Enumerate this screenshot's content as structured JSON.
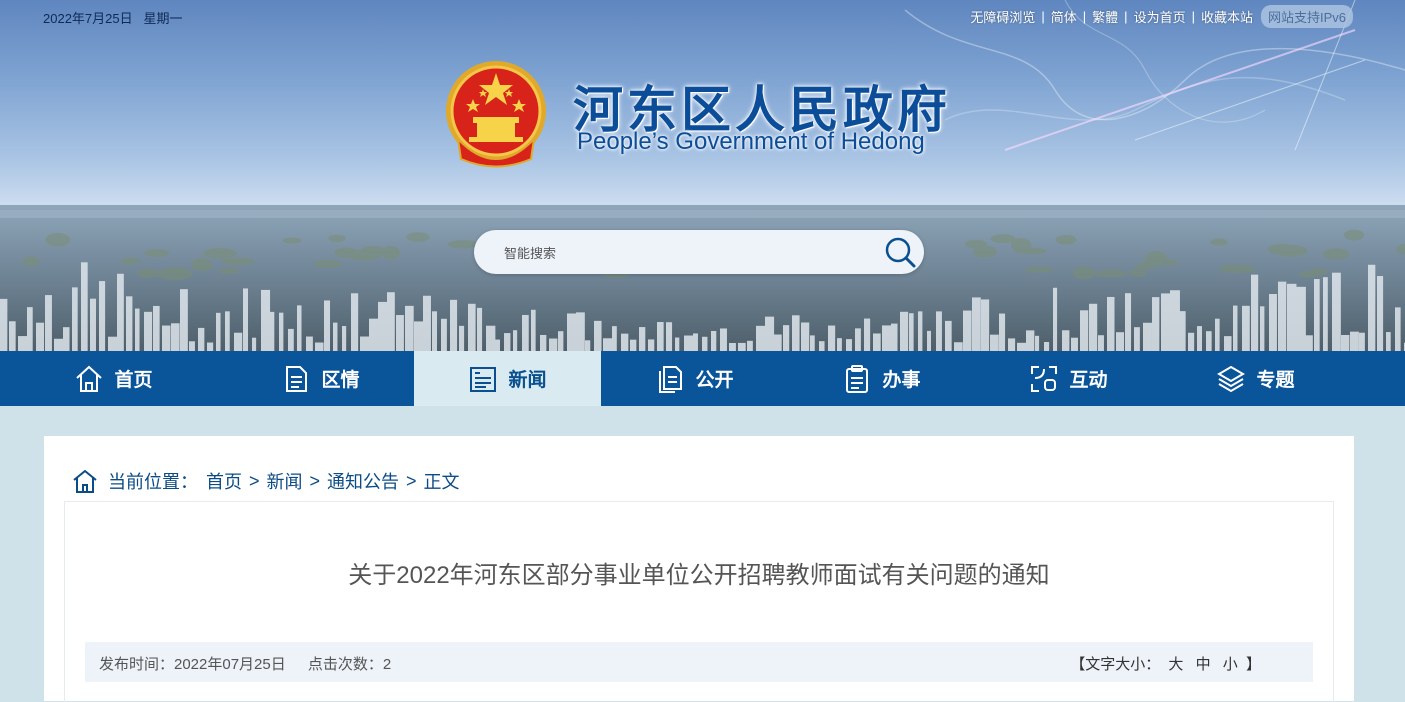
{
  "header": {
    "date": "2022年7月25日",
    "weekday": "星期一",
    "links": [
      "无障碍浏览",
      "简体",
      "繁體",
      "设为首页",
      "收藏本站"
    ],
    "ipv6_badge": "网站支持IPv6",
    "title": "河东区人民政府",
    "subtitle": "People’s Government of Hedong"
  },
  "search": {
    "placeholder": "智能搜索"
  },
  "nav": {
    "items": [
      {
        "label": "首页",
        "icon": "home-icon"
      },
      {
        "label": "区情",
        "icon": "document-icon"
      },
      {
        "label": "新闻",
        "icon": "news-icon"
      },
      {
        "label": "公开",
        "icon": "files-icon"
      },
      {
        "label": "办事",
        "icon": "clipboard-icon"
      },
      {
        "label": "互动",
        "icon": "interaction-icon"
      },
      {
        "label": "专题",
        "icon": "layers-icon"
      }
    ],
    "active": "新闻"
  },
  "breadcrumb": {
    "prefix": "当前位置：",
    "items": [
      "首页",
      "新闻",
      "通知公告",
      "正文"
    ]
  },
  "article": {
    "title": "关于2022年河东区部分事业单位公开招聘教师面试有关问题的通知",
    "publish_label": "发布时间：2022年07月25日",
    "views_label": "点击次数：2",
    "font_size_label": "【文字大小：",
    "font_sizes": [
      "大",
      "中",
      "小"
    ],
    "font_size_close": "】"
  },
  "colors": {
    "nav_bg": "#0a5499",
    "nav_active_bg": "#d9ebf1",
    "title_blue": "#0b4d98",
    "page_bg": "#cfe1e9"
  }
}
